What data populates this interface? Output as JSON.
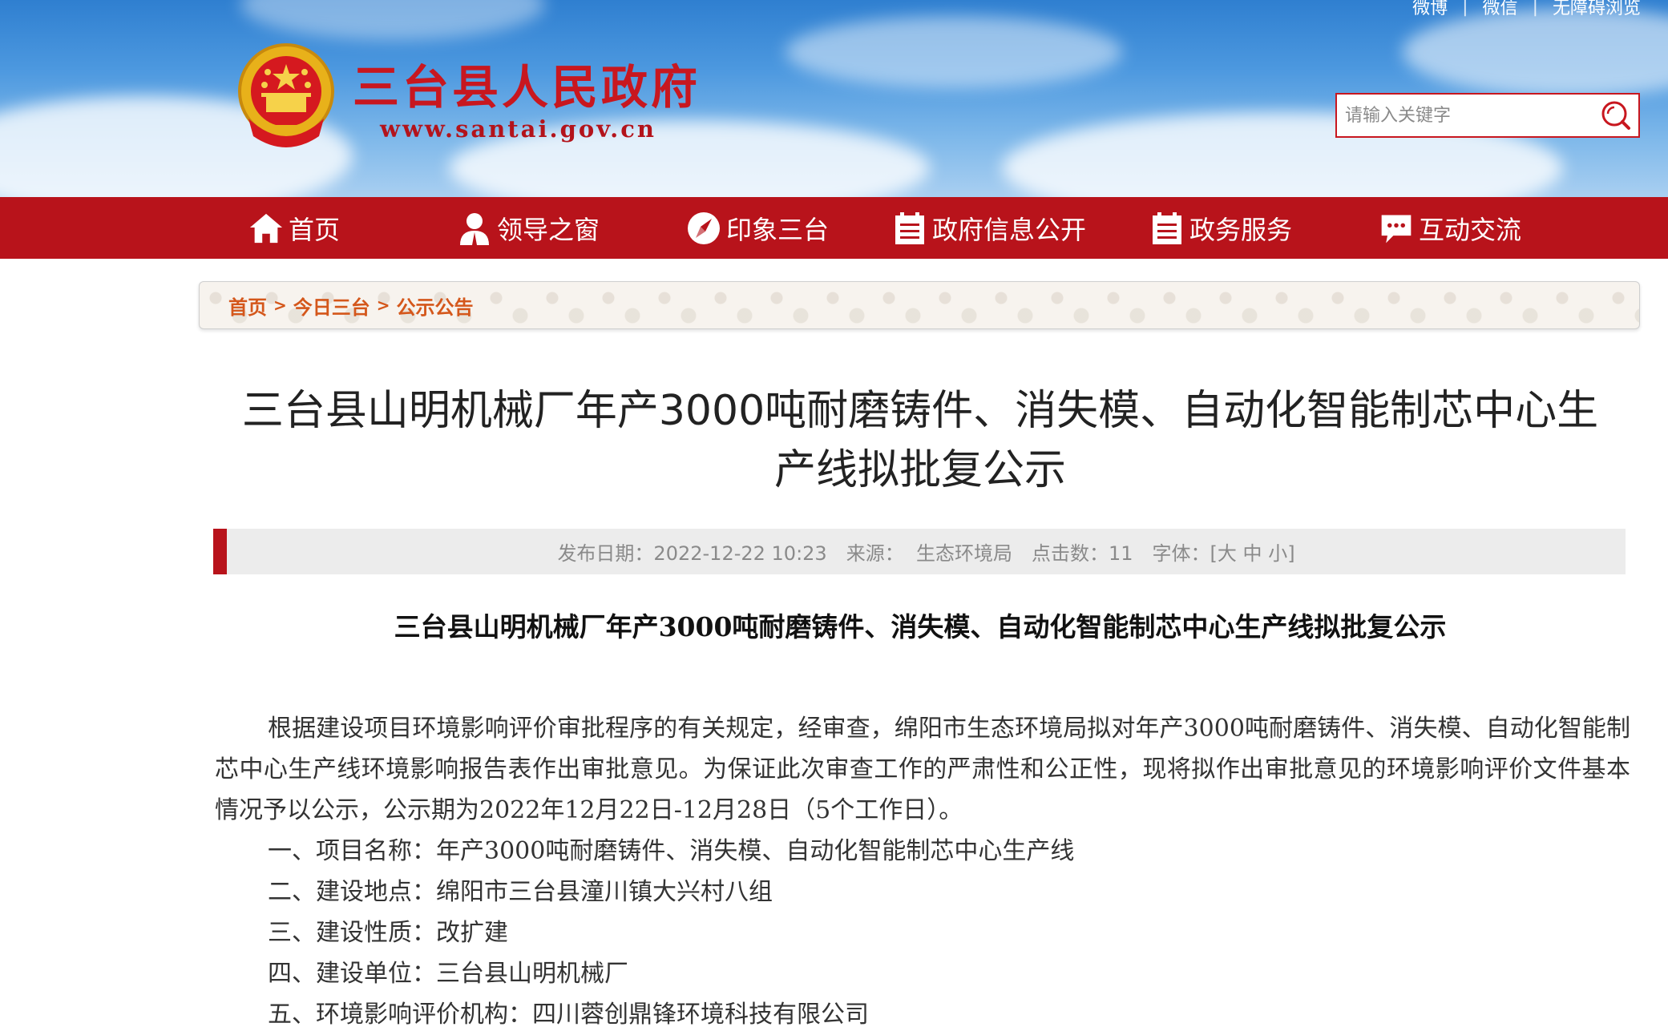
{
  "header": {
    "site_name": "三台县人民政府",
    "site_url": "www.santai.gov.cn",
    "top_links": [
      "微博",
      "微信",
      "无障碍浏览"
    ],
    "search_placeholder": "请输入关键字",
    "emblem_icon": "national-emblem-icon",
    "colors": {
      "brand_red": "#b8131b",
      "sky_blue": "#4c98df"
    }
  },
  "nav": {
    "items": [
      {
        "label": "首页",
        "icon": "home-icon"
      },
      {
        "label": "领导之窗",
        "icon": "person-icon"
      },
      {
        "label": "印象三台",
        "icon": "compass-icon"
      },
      {
        "label": "政府信息公开",
        "icon": "document-list-icon"
      },
      {
        "label": "政务服务",
        "icon": "document-list-icon"
      },
      {
        "label": "互动交流",
        "icon": "chat-icon"
      }
    ]
  },
  "breadcrumb": {
    "items": [
      "首页",
      "今日三台",
      "公示公告"
    ],
    "separator": ">"
  },
  "article": {
    "title_line1": "三台县山明机械厂年产3000吨耐磨铸件、消失模、自动化智能制芯中心生",
    "title_line2": "产线拟批复公示",
    "meta": {
      "publish_date": "发布日期：2022-12-22 10:23",
      "source": "来源：  生态环境局",
      "clicks": "点击数：11",
      "font_size_label": "字体：[",
      "font_large": "大",
      "font_medium": "中",
      "font_small": "小",
      "font_close": "]"
    },
    "heading": "三台县山明机械厂年产3000吨耐磨铸件、消失模、自动化智能制芯中心生产线拟批复公示",
    "paragraph": "根据建设项目环境影响评价审批程序的有关规定，经审查，绵阳市生态环境局拟对年产3000吨耐磨铸件、消失模、自动化智能制芯中心生产线环境影响报告表作出审批意见。为保证此次审查工作的严肃性和公正性，现将拟作出审批意见的环境影响评价文件基本情况予以公示，公示期为2022年12月22日-12月28日（5个工作日）。",
    "items": [
      "一、项目名称：年产3000吨耐磨铸件、消失模、自动化智能制芯中心生产线",
      "二、建设地点：绵阳市三台县潼川镇大兴村八组",
      "三、建设性质：改扩建",
      "四、建设单位：三台县山明机械厂",
      "五、环境影响评价机构：四川蓉创鼎锋环境科技有限公司"
    ]
  }
}
